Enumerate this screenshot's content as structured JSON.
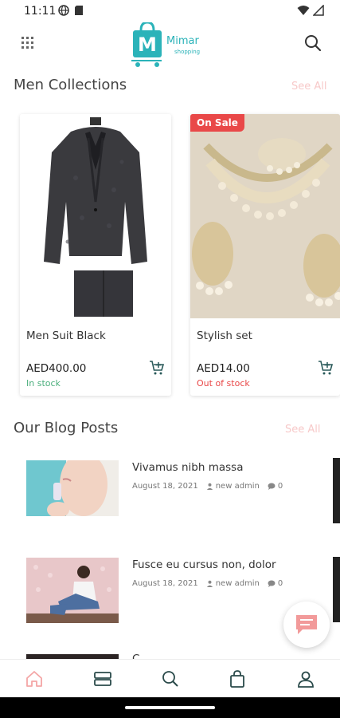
{
  "status_bar": {
    "time": "11:11"
  },
  "header": {
    "logo_text": "Mimar",
    "logo_sub": "shopping"
  },
  "men_collections": {
    "title": "Men Collections",
    "see_all": "See All",
    "products": [
      {
        "name": "Men Suit Black",
        "price": "AED400.00",
        "stock": "In stock",
        "stock_color": "#4caf7d",
        "badge": ""
      },
      {
        "name": "Stylish set",
        "price": "AED14.00",
        "stock": "Out of stock",
        "stock_color": "#e94848",
        "badge": "On Sale"
      }
    ]
  },
  "blog": {
    "title": "Our Blog Posts",
    "see_all": "See All",
    "posts": [
      {
        "title": "Vivamus nibh massa",
        "date": "August 18, 2021",
        "author": "new admin",
        "comments": "0"
      },
      {
        "title": "Fusce eu cursus non, dolor",
        "date": "August 18, 2021",
        "author": "new admin",
        "comments": "0"
      },
      {
        "title": "C...",
        "date": "",
        "author": "",
        "comments": ""
      }
    ]
  },
  "colors": {
    "accent": "#2bb3b9",
    "see_all": "#f7c9c9",
    "home_active": "#f4a6a6"
  },
  "bottom_nav": [
    "home-icon",
    "categories-icon",
    "search-icon",
    "bag-icon",
    "profile-icon"
  ]
}
